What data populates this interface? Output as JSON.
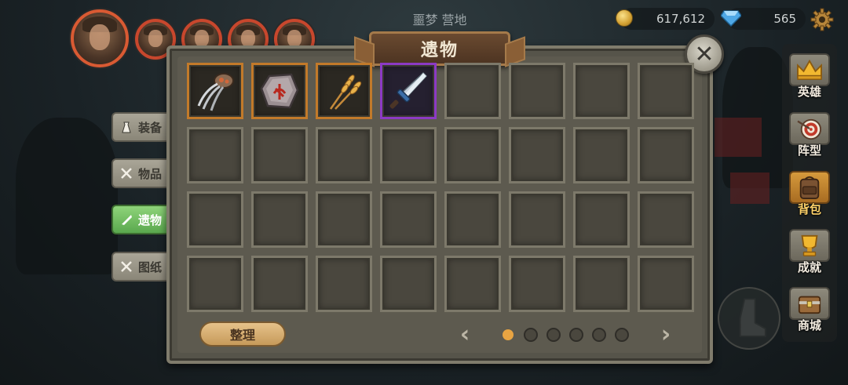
{
  "header": {
    "location": "噩梦 营地",
    "gold": "617,612",
    "gems": "565"
  },
  "heroes": [
    {
      "name": "hero-portrait-1"
    },
    {
      "name": "hero-portrait-2"
    },
    {
      "name": "hero-portrait-3"
    },
    {
      "name": "hero-portrait-4"
    },
    {
      "name": "hero-portrait-5"
    }
  ],
  "panel": {
    "title": "遗物",
    "close_label": "✕",
    "sort_label": "整理",
    "prev_label": "‹",
    "next_label": "›",
    "current_page": 1,
    "total_pages": 6
  },
  "tabs": [
    {
      "label": "装备",
      "icon": "bag-icon",
      "active": false
    },
    {
      "label": "物品",
      "icon": "crossed-tools-icon",
      "active": false
    },
    {
      "label": "遗物",
      "icon": "quill-icon",
      "active": true
    },
    {
      "label": "图纸",
      "icon": "crossed-tools-icon",
      "active": false
    }
  ],
  "slots": [
    {
      "item": "claw-gauntlet-icon",
      "rarity": "orange"
    },
    {
      "item": "rune-stone-icon",
      "rarity": "orange"
    },
    {
      "item": "wheat-bundle-icon",
      "rarity": "orange"
    },
    {
      "item": "sword-icon",
      "rarity": "purple"
    }
  ],
  "empty_slot_count": 28,
  "right_nav": [
    {
      "label": "英雄",
      "icon": "crown-icon",
      "active": false
    },
    {
      "label": "阵型",
      "icon": "target-icon",
      "active": false
    },
    {
      "label": "背包",
      "icon": "backpack-icon",
      "active": true
    },
    {
      "label": "成就",
      "icon": "trophy-icon",
      "active": false
    },
    {
      "label": "商城",
      "icon": "chest-icon",
      "active": false
    }
  ],
  "colors": {
    "rarity_orange": "#c27a2a",
    "rarity_purple": "#8c3ac4",
    "active_tab": "#5aa84e",
    "active_page_dot": "#e8a442"
  }
}
